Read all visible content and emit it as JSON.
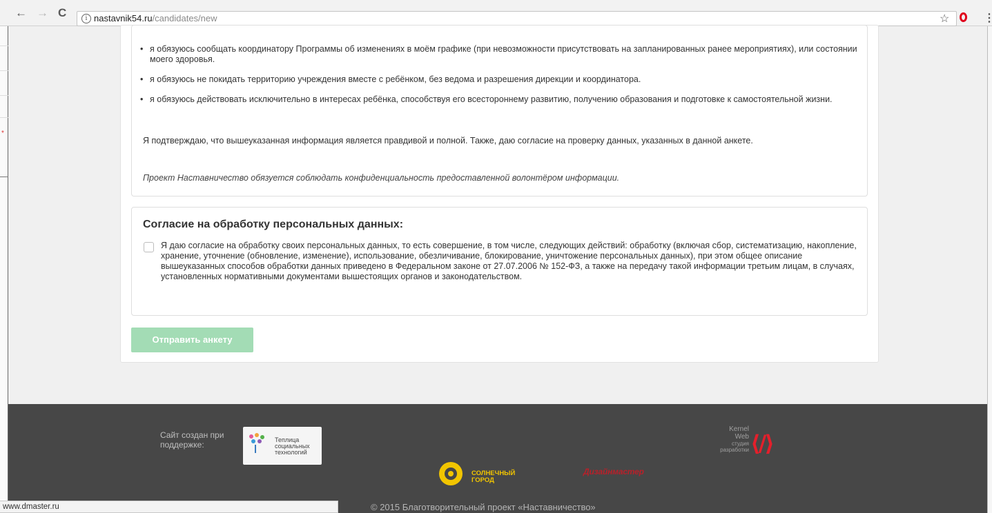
{
  "browser": {
    "url_host": "nastavnik54.ru",
    "url_path": "/candidates/new",
    "back_icon": "←",
    "forward_icon": "→",
    "reload_icon": "C",
    "info_icon": "i",
    "star_icon": "☆",
    "menu_icon": "⋮"
  },
  "obligations": {
    "items": [
      "я обязуюсь сообщать координатору Программы об изменениях в моём графике (при невозможности присутствовать на запланированных ранее мероприятиях), или состоянии моего здоровья.",
      "я обязуюсь не покидать территорию учреждения вместе с ребёнком, без ведома и разрешения дирекции и координатора.",
      "я обязуюсь действовать исключительно в интересах ребёнка, способствуя его всестороннему развитию, получению образования и подготовке к самостоятельной жизни."
    ],
    "confirmation": "Я подтверждаю, что вышеуказанная информация является правдивой и полной. Также, даю согласие на проверку данных, указанных в данной анкете.",
    "privacy_note": "Проект Наставничество обязуется соблюдать конфиденциальность предоставленной волонтёром информации."
  },
  "consent": {
    "title": "Согласие на обработку персональных данных:",
    "text": "Я даю согласие на обработку своих персональных данных, то есть совершение, в том числе, следующих действий: обработку (включая сбор, систематизацию, накопление, хранение, уточнение (обновление, изменение), использование, обезличивание, блокирование, уничтожение персональных данных), при этом общее описание вышеуказанных способов обработки данных приведено в Федеральном законе от 27.07.2006 № 152-ФЗ, а также на передачу такой информации третьим лицам, в случаях, установленных нормативными документами вышестоящих органов и законодательством.",
    "checked": false
  },
  "form": {
    "submit_label": "Отправить анкету",
    "submit_color": "#a3dcb5"
  },
  "footer": {
    "support_label": "Сайт создан при поддержке:",
    "teplica_text": "Теплица социальных технологий",
    "sunny_city": "СОЛНЕЧНЫЙ ГОРОД",
    "designmaster": "Дизайнмастер",
    "kernel_line1": "Kernel",
    "kernel_line2": "Web",
    "kernel_line3": "студия разработки",
    "kernel_logo": "⟨/⟩",
    "copyright": "© 2015 Благотворительный проект «Наставничество»",
    "bg_color": "#474747"
  },
  "status_bar": {
    "link": "www.dmaster.ru"
  }
}
